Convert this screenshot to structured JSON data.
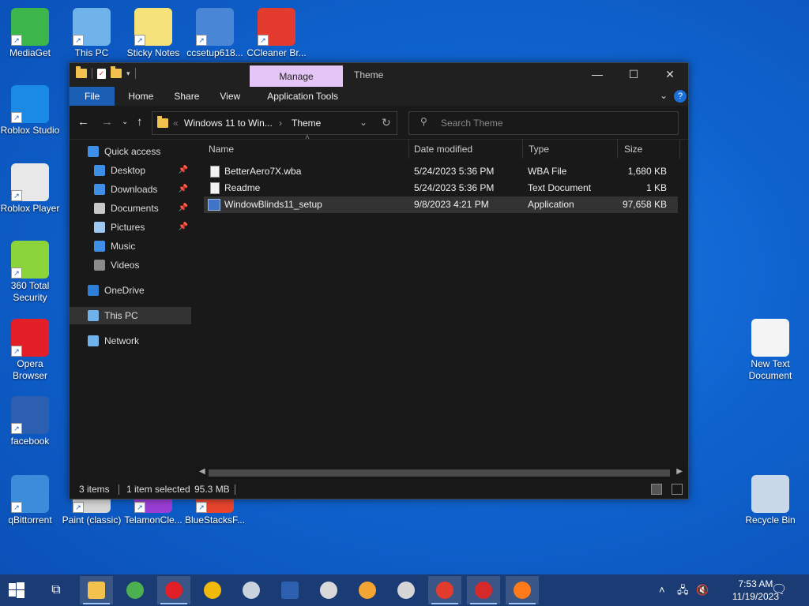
{
  "desktop_icons": [
    {
      "label": "MediaGet",
      "icon": "mediaget-icon",
      "color": "#3cb54a"
    },
    {
      "label": "This PC",
      "icon": "computer-icon",
      "color": "#6fb3ea"
    },
    {
      "label": "Sticky Notes (classic)",
      "icon": "sticky-notes-icon",
      "color": "#f6e27a"
    },
    {
      "label": "ccsetup618...",
      "icon": "ccsetup-icon",
      "color": "#4a86d6"
    },
    {
      "label": "CCleaner Br...",
      "icon": "ccleaner-icon",
      "color": "#e33b2e"
    },
    {
      "label": "Roblox Studio",
      "icon": "roblox-studio-icon",
      "color": "#1a8ae5"
    },
    {
      "label": "Roblox Player",
      "icon": "roblox-player-icon",
      "color": "#e8e8e8"
    },
    {
      "label": "360 Total Security",
      "icon": "360-security-icon",
      "color": "#8bd43a"
    },
    {
      "label": "Opera Browser",
      "icon": "opera-icon",
      "color": "#e21e26"
    },
    {
      "label": "facebook",
      "icon": "facebook-icon",
      "color": "#2d5fb0"
    },
    {
      "label": "qBittorrent",
      "icon": "qbittorrent-icon",
      "color": "#3b8cd9"
    },
    {
      "label": "Paint (classic)",
      "icon": "paint-icon",
      "color": "#d6d6d6"
    },
    {
      "label": "TelamonCle...",
      "icon": "telamon-icon",
      "color": "#9a3fd6"
    },
    {
      "label": "BlueStacksF...",
      "icon": "bluestacks-icon",
      "color": "#e8442e"
    },
    {
      "label": "New Text Document",
      "icon": "text-document-icon",
      "color": "#f4f4f4"
    },
    {
      "label": "Recycle Bin",
      "icon": "recycle-bin-icon",
      "color": "#c9d9ea"
    }
  ],
  "window": {
    "title": "Theme",
    "manage_tab": "Manage",
    "controls": {
      "minimize": "—",
      "maximize": "☐",
      "close": "✕"
    },
    "ribbon_tabs": [
      "File",
      "Home",
      "Share",
      "View",
      "Application Tools"
    ],
    "help": "?",
    "address": {
      "crumb1": "Windows 11 to Win...",
      "crumb2": "Theme",
      "overflow": "«"
    },
    "search_placeholder": "Search Theme",
    "sidebar": [
      {
        "label": "Quick access",
        "icon": "star-icon",
        "color": "#3f8fe8",
        "pinned": false
      },
      {
        "label": "Desktop",
        "icon": "desktop-icon",
        "color": "#3d8ee6",
        "pinned": true
      },
      {
        "label": "Downloads",
        "icon": "downloads-icon",
        "color": "#3f8fe8",
        "pinned": true
      },
      {
        "label": "Documents",
        "icon": "documents-icon",
        "color": "#c8c8c8",
        "pinned": true
      },
      {
        "label": "Pictures",
        "icon": "pictures-icon",
        "color": "#9ec7ef",
        "pinned": true
      },
      {
        "label": "Music",
        "icon": "music-icon",
        "color": "#3f8fe8",
        "pinned": false
      },
      {
        "label": "Videos",
        "icon": "videos-icon",
        "color": "#8a8a8a",
        "pinned": false
      },
      {
        "label": "OneDrive",
        "icon": "onedrive-icon",
        "color": "#2d7fd8",
        "pinned": false
      },
      {
        "label": "This PC",
        "icon": "this-pc-icon",
        "color": "#6fb3ea",
        "pinned": false
      },
      {
        "label": "Network",
        "icon": "network-icon",
        "color": "#6fb3ea",
        "pinned": false
      }
    ],
    "columns": [
      "Name",
      "Date modified",
      "Type",
      "Size"
    ],
    "files": [
      {
        "name": "BetterAero7X.wba",
        "date": "5/24/2023 5:36 PM",
        "type": "WBA File",
        "size": "1,680 KB"
      },
      {
        "name": "Readme",
        "date": "5/24/2023 5:36 PM",
        "type": "Text Document",
        "size": "1 KB"
      },
      {
        "name": "WindowBlinds11_setup",
        "date": "9/8/2023 4:21 PM",
        "type": "Application",
        "size": "97,658 KB"
      }
    ],
    "status": {
      "items": "3 items",
      "selected": "1 item selected",
      "size": "95.3 MB"
    }
  },
  "taskbar": {
    "apps": [
      {
        "name": "file-explorer-icon",
        "color": "#f2c14e"
      },
      {
        "name": "chrome-icon",
        "color": "#4caf50"
      },
      {
        "name": "opera-taskbar-icon",
        "color": "#e21e26"
      },
      {
        "name": "binance-icon",
        "color": "#f0b90b"
      },
      {
        "name": "warships-icon",
        "color": "#c9d2dd"
      },
      {
        "name": "facebook-taskbar-icon",
        "color": "#2d5fb0"
      },
      {
        "name": "world-of-tanks-icon",
        "color": "#d9d9d9"
      },
      {
        "name": "browser-icon",
        "color": "#f2a533"
      },
      {
        "name": "paint-taskbar-icon",
        "color": "#d6d6d6"
      },
      {
        "name": "ccleaner-taskbar-icon",
        "color": "#e33b2e"
      },
      {
        "name": "game-icon",
        "color": "#d62a2a"
      },
      {
        "name": "firefox-icon",
        "color": "#ff7a1a"
      }
    ],
    "time": "7:53 AM",
    "date": "11/19/2023"
  }
}
